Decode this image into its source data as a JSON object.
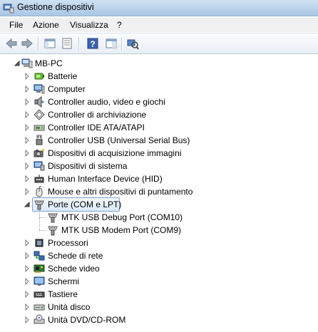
{
  "window": {
    "title": "Gestione dispositivi"
  },
  "menu": [
    "File",
    "Azione",
    "Visualizza",
    "?"
  ],
  "toolbar": {
    "buttons": [
      "back-arrow-icon",
      "forward-arrow-icon",
      "console-tree-icon",
      "properties-icon",
      "help-icon",
      "console-icon",
      "scan-hardware-icon"
    ]
  },
  "tree": {
    "root": "MB-PC",
    "categories": [
      {
        "label": "Batterie",
        "icon": "battery-icon",
        "expanded": false
      },
      {
        "label": "Computer",
        "icon": "computer-icon",
        "expanded": false
      },
      {
        "label": "Controller audio, video e giochi",
        "icon": "speaker-icon",
        "expanded": false
      },
      {
        "label": "Controller di archiviazione",
        "icon": "storage-controller-icon",
        "expanded": false
      },
      {
        "label": "Controller IDE ATA/ATAPI",
        "icon": "ide-controller-icon",
        "expanded": false
      },
      {
        "label": "Controller USB (Universal Serial Bus)",
        "icon": "usb-icon",
        "expanded": false
      },
      {
        "label": "Dispositivi di acquisizione immagini",
        "icon": "camera-icon",
        "expanded": false
      },
      {
        "label": "Dispositivi di sistema",
        "icon": "system-device-icon",
        "expanded": false
      },
      {
        "label": "Human Interface Device (HID)",
        "icon": "hid-icon",
        "expanded": false
      },
      {
        "label": "Mouse e altri dispositivi di puntamento",
        "icon": "mouse-icon",
        "expanded": false
      },
      {
        "label": "Porte (COM e LPT)",
        "icon": "port-icon",
        "expanded": true,
        "selected": true,
        "children": [
          {
            "label": "MTK USB Debug Port (COM10)",
            "icon": "port-icon"
          },
          {
            "label": "MTK USB Modem Port (COM9)",
            "icon": "port-icon"
          }
        ]
      },
      {
        "label": "Processori",
        "icon": "processor-icon",
        "expanded": false
      },
      {
        "label": "Schede di rete",
        "icon": "network-adapter-icon",
        "expanded": false
      },
      {
        "label": "Schede video",
        "icon": "display-adapter-icon",
        "expanded": false
      },
      {
        "label": "Schermi",
        "icon": "monitor-icon",
        "expanded": false
      },
      {
        "label": "Tastiere",
        "icon": "keyboard-icon",
        "expanded": false
      },
      {
        "label": "Unità disco",
        "icon": "disk-drive-icon",
        "expanded": false
      },
      {
        "label": "Unità DVD/CD-ROM",
        "icon": "dvd-drive-icon",
        "expanded": false
      }
    ]
  }
}
